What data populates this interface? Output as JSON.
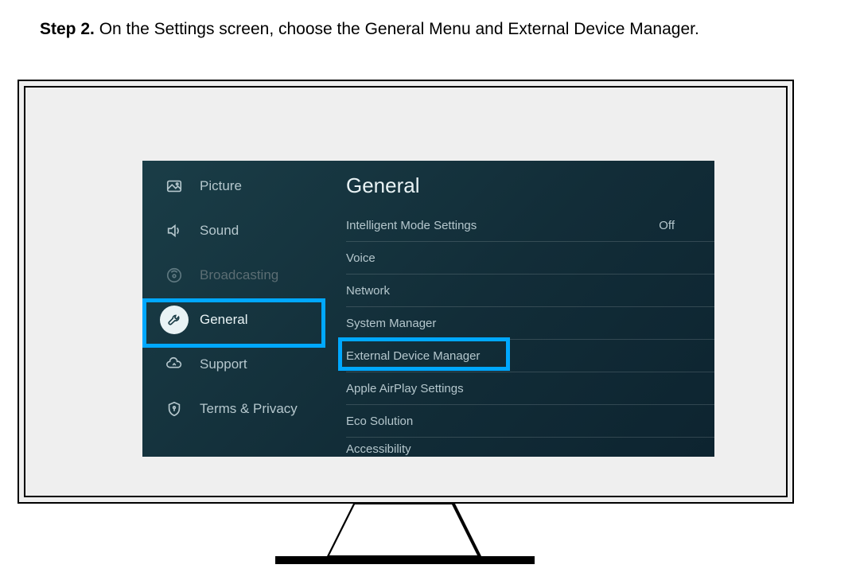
{
  "instruction": {
    "step_label": "Step 2.",
    "text": "On the Settings screen, choose the General Menu and External Device Manager."
  },
  "sidebar": {
    "items": [
      {
        "label": "Picture",
        "icon": "picture-icon"
      },
      {
        "label": "Sound",
        "icon": "sound-icon"
      },
      {
        "label": "Broadcasting",
        "icon": "broadcast-icon",
        "disabled": true
      },
      {
        "label": "General",
        "icon": "wrench-icon",
        "selected": true
      },
      {
        "label": "Support",
        "icon": "cloud-icon"
      },
      {
        "label": "Terms & Privacy",
        "icon": "shield-icon"
      }
    ]
  },
  "content": {
    "title": "General",
    "items": [
      {
        "label": "Intelligent Mode Settings",
        "value": "Off"
      },
      {
        "label": "Voice",
        "value": ""
      },
      {
        "label": "Network",
        "value": ""
      },
      {
        "label": "System Manager",
        "value": ""
      },
      {
        "label": "External Device Manager",
        "value": "",
        "highlighted": true
      },
      {
        "label": "Apple AirPlay Settings",
        "value": ""
      },
      {
        "label": "Eco Solution",
        "value": ""
      }
    ],
    "cut_off_item": "Accessibility"
  }
}
